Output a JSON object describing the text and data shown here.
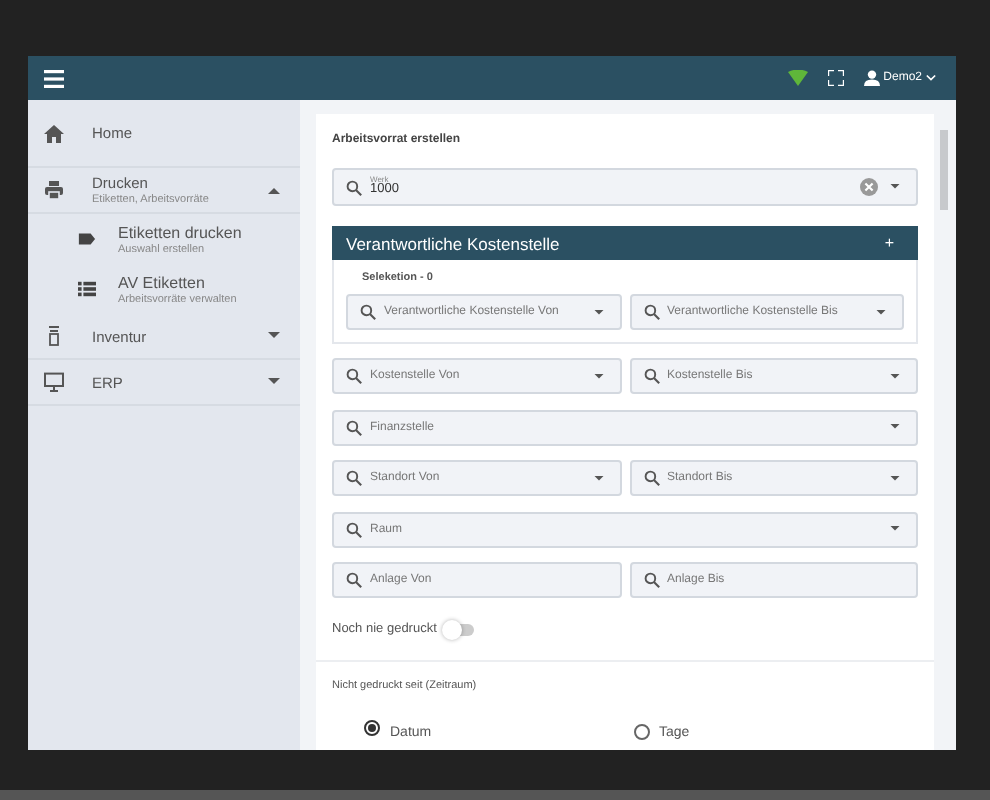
{
  "header": {
    "user": "Demo2",
    "online": true
  },
  "sidebar": {
    "items": [
      {
        "label": "Home",
        "kind": "home"
      },
      {
        "label": "Drucken",
        "subtitle": "Etiketten, Arbeitsvorräte",
        "kind": "printer",
        "expanded": true,
        "children": [
          {
            "label": "Etiketten drucken",
            "subtitle": "Auswahl erstellen",
            "kind": "tag"
          },
          {
            "label": "AV Etiketten",
            "subtitle": "Arbeitsvorräte verwalten",
            "kind": "list"
          }
        ]
      },
      {
        "label": "Inventur",
        "kind": "scanner",
        "expanded": false
      },
      {
        "label": "ERP",
        "kind": "monitor",
        "expanded": false
      }
    ]
  },
  "form": {
    "title": "Arbeitsvorrat erstellen",
    "werk": {
      "label": "Werk",
      "value": "1000"
    },
    "panel": {
      "title": "Verantwortliche Kostenstelle",
      "add": "+",
      "selection": "Seleketion - 0",
      "fields": [
        {
          "placeholder": "Verantwortliche Kostenstelle Von",
          "kind": "select"
        },
        {
          "placeholder": "Verantwortliche Kostenstelle Bis",
          "kind": "select"
        }
      ]
    },
    "rows": [
      [
        {
          "placeholder": "Kostenstelle Von",
          "kind": "select"
        },
        {
          "placeholder": "Kostenstelle Bis",
          "kind": "select"
        }
      ],
      [
        {
          "placeholder": "Finanzstelle",
          "kind": "select"
        }
      ],
      [
        {
          "placeholder": "Standort Von",
          "kind": "select"
        },
        {
          "placeholder": "Standort Bis",
          "kind": "select"
        }
      ],
      [
        {
          "placeholder": "Raum",
          "kind": "select"
        }
      ],
      [
        {
          "placeholder": "Anlage Von",
          "kind": "text"
        },
        {
          "placeholder": "Anlage Bis",
          "kind": "text"
        }
      ]
    ],
    "toggle": {
      "label": "Noch nie gedruckt",
      "on": false
    },
    "period": {
      "label": "Nicht gedruckt seit (Zeitraum)",
      "options": [
        {
          "label": "Datum",
          "selected": true
        },
        {
          "label": "Tage",
          "selected": false
        }
      ]
    }
  }
}
